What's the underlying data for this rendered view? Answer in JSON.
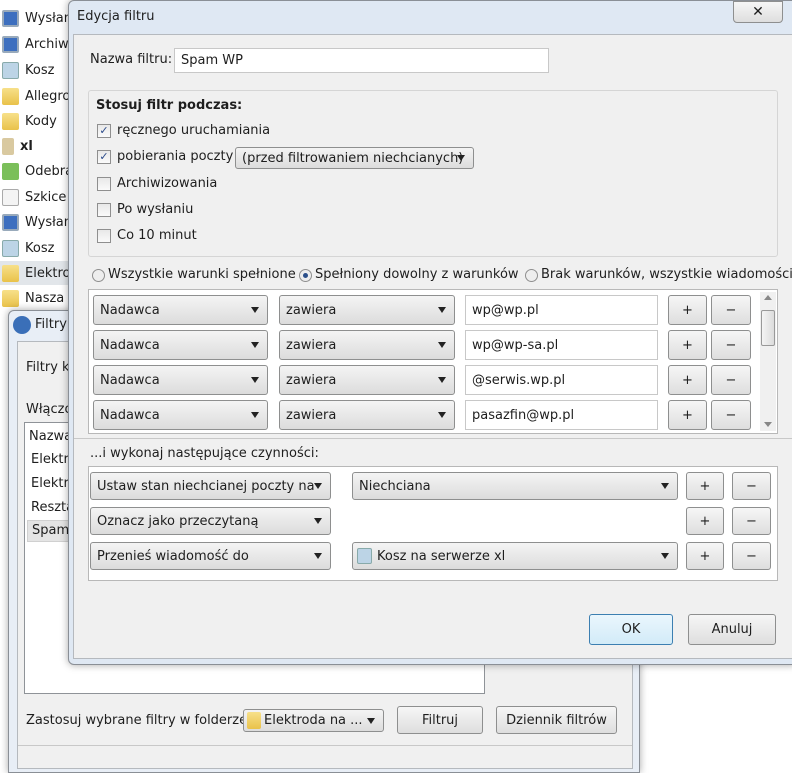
{
  "folders": [
    {
      "label": "Wysłan",
      "icon": "sent-icon"
    },
    {
      "label": "Archiwu",
      "icon": "archive-icon"
    },
    {
      "label": "Kosz",
      "icon": "trash-icon"
    },
    {
      "label": "Allegro",
      "icon": "folder-icon"
    },
    {
      "label": "Kody",
      "icon": "folder-icon"
    },
    {
      "label": "xl",
      "icon": "account-icon"
    },
    {
      "label": "Odebra",
      "icon": "inbox-icon"
    },
    {
      "label": "Szkice",
      "icon": "drafts-icon"
    },
    {
      "label": "Wysłan",
      "icon": "sent-icon"
    },
    {
      "label": "Kosz",
      "icon": "trash-icon"
    },
    {
      "label": "Elektro",
      "icon": "folder-icon"
    },
    {
      "label": "Nasza",
      "icon": "folder-icon"
    }
  ],
  "filters_window": {
    "title": "Filtry",
    "for_account_label": "Filtry k",
    "enabled_label": "Włączo",
    "list_header": "Nazwa",
    "list_items": [
      "Elektro",
      "Elektro",
      "Reszta",
      "Spam"
    ],
    "selected_index": 3,
    "apply_label": "Zastosuj wybrane filtry w folderze:",
    "folder_select": "Elektroda na ...",
    "filter_button": "Filtruj",
    "log_button": "Dziennik filtrów"
  },
  "dialog": {
    "title": "Edycja filtru",
    "close_icon": "close-icon",
    "name_label": "Nazwa filtru:",
    "name_value": "Spam WP",
    "apply_group_title": "Stosuj filtr podczas:",
    "apply_options": [
      {
        "label": "ręcznego uruchamiania",
        "checked": true
      },
      {
        "label": "pobierania poczty",
        "checked": true
      },
      {
        "label": "Archiwizowania",
        "checked": false
      },
      {
        "label": "Po wysłaniu",
        "checked": false
      },
      {
        "label": "Co 10 minut",
        "checked": false
      }
    ],
    "fetch_timing": "(przed filtrowaniem niechcianych)",
    "match_options": [
      {
        "label": "Wszystkie warunki spełnione",
        "selected": false
      },
      {
        "label": "Spełniony dowolny z warunków",
        "selected": true
      },
      {
        "label": "Brak warunków, wszystkie wiadomości",
        "selected": false
      }
    ],
    "conditions": [
      {
        "field": "Nadawca",
        "op": "zawiera",
        "value": "wp@wp.pl"
      },
      {
        "field": "Nadawca",
        "op": "zawiera",
        "value": "wp@wp-sa.pl"
      },
      {
        "field": "Nadawca",
        "op": "zawiera",
        "value": "@serwis.wp.pl"
      },
      {
        "field": "Nadawca",
        "op": "zawiera",
        "value": "pasazfin@wp.pl"
      }
    ],
    "add_label": "+",
    "remove_label": "−",
    "actions_label": "...i wykonaj następujące czynności:",
    "actions": [
      {
        "action": "Ustaw stan niechcianej poczty na",
        "target": "Niechciana"
      },
      {
        "action": "Oznacz jako przeczytaną",
        "target": ""
      },
      {
        "action": "Przenieś wiadomość do",
        "target": "Kosz na serwerze xl"
      }
    ],
    "ok_label": "OK",
    "cancel_label": "Anuluj"
  }
}
